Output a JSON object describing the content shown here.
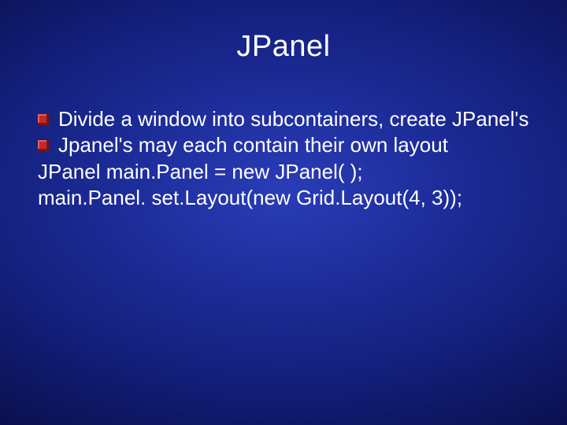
{
  "slide": {
    "title": "JPanel",
    "bullets": [
      {
        "text": "Divide a window into subcontainers, create JPanel's"
      },
      {
        "text": "Jpanel's may each contain their own layout"
      }
    ],
    "code_lines": [
      "JPanel main.Panel = new JPanel( );",
      "main.Panel. set.Layout(new Grid.Layout(4, 3));"
    ]
  }
}
